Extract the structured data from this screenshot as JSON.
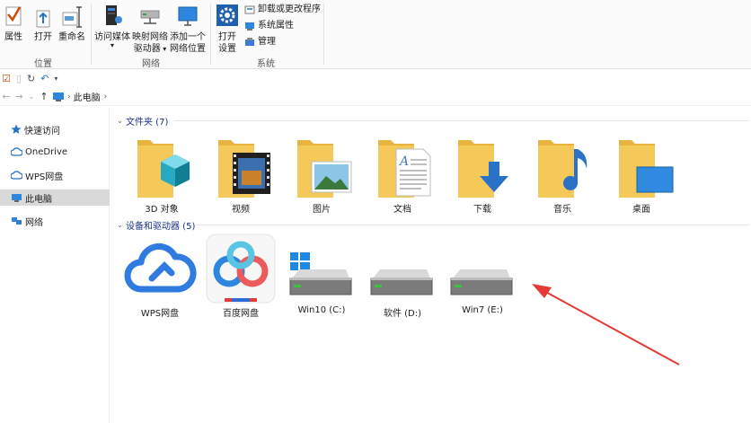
{
  "ribbon": {
    "location": {
      "properties": "属性",
      "open": "打开",
      "rename": "重命名",
      "group": "位置"
    },
    "network": {
      "access_media": "访问媒体",
      "map_drive_1": "映射网络",
      "map_drive_2": "驱动器",
      "add_location_1": "添加一个",
      "add_location_2": "网络位置",
      "group": "网络"
    },
    "system": {
      "open_settings_1": "打开",
      "open_settings_2": "设置",
      "uninstall": "卸载或更改程序",
      "system_properties": "系统属性",
      "manage": "管理",
      "group": "系统"
    }
  },
  "address": {
    "crumb": "此电脑"
  },
  "sidebar": {
    "items": [
      {
        "label": "快速访问"
      },
      {
        "label": "OneDrive"
      },
      {
        "label": "WPS网盘"
      },
      {
        "label": "此电脑"
      },
      {
        "label": "网络"
      }
    ]
  },
  "folders": {
    "header": "文件夹 (7)",
    "items": [
      {
        "label": "3D 对象"
      },
      {
        "label": "视频"
      },
      {
        "label": "图片"
      },
      {
        "label": "文档"
      },
      {
        "label": "下载"
      },
      {
        "label": "音乐"
      },
      {
        "label": "桌面"
      }
    ]
  },
  "devices": {
    "header": "设备和驱动器 (5)",
    "items": [
      {
        "label": "WPS网盘"
      },
      {
        "label": "百度网盘"
      },
      {
        "label": "Win10 (C:)"
      },
      {
        "label": "软件 (D:)"
      },
      {
        "label": "Win7 (E:)"
      }
    ]
  },
  "colors": {
    "folder": "#f5c85a",
    "accent": "#1e3287",
    "arrow": "#e53935",
    "wps_blue": "#2f7be0"
  }
}
